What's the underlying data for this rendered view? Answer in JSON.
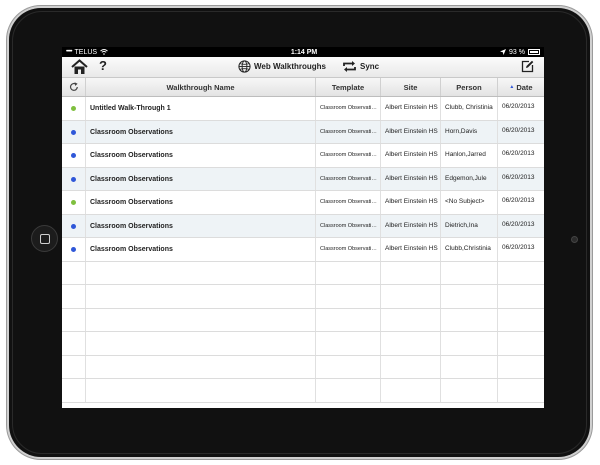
{
  "status_bar": {
    "carrier": "TELUS",
    "time": "1:14 PM",
    "battery": "93 %"
  },
  "toolbar": {
    "help_label": "?",
    "web_walkthroughs_label": "Web Walkthroughs",
    "sync_label": "Sync"
  },
  "table": {
    "headers": {
      "name": "Walkthrough Name",
      "template": "Template",
      "site": "Site",
      "person": "Person",
      "date_sort_indicator": "▲",
      "date": "Date"
    },
    "rows": [
      {
        "status": "green",
        "name": "Untitled Walk-Through 1",
        "template": "Classroom Observati…",
        "site": "Albert Einstein HS",
        "person": "Clubb, Christinia",
        "date": "06/20/2013"
      },
      {
        "status": "blue",
        "name": "Classroom Observations",
        "template": "Classroom Observati…",
        "site": "Albert Einstein HS",
        "person": "Horn,Davis",
        "date": "06/20/2013"
      },
      {
        "status": "blue",
        "name": "Classroom Observations",
        "template": "Classroom Observati…",
        "site": "Albert Einstein HS",
        "person": "Hanlon,Jarred",
        "date": "06/20/2013"
      },
      {
        "status": "blue",
        "name": "Classroom Observations",
        "template": "Classroom Observati…",
        "site": "Albert Einstein HS",
        "person": "Edgemon,Jule",
        "date": "06/20/2013"
      },
      {
        "status": "green",
        "name": "Classroom Observations",
        "template": "Classroom Observati…",
        "site": "Albert Einstein HS",
        "person": "<No Subject>",
        "date": "06/20/2013"
      },
      {
        "status": "blue",
        "name": "Classroom Observations",
        "template": "Classroom Observati…",
        "site": "Albert Einstein HS",
        "person": "Dietrich,Ina",
        "date": "06/20/2013"
      },
      {
        "status": "blue",
        "name": "Classroom Observations",
        "template": "Classroom Observati…",
        "site": "Albert Einstein HS",
        "person": "Clubb,Christinia",
        "date": "06/20/2013"
      }
    ]
  },
  "colors": {
    "green": "#7fbf3f",
    "blue": "#2f57d8"
  }
}
